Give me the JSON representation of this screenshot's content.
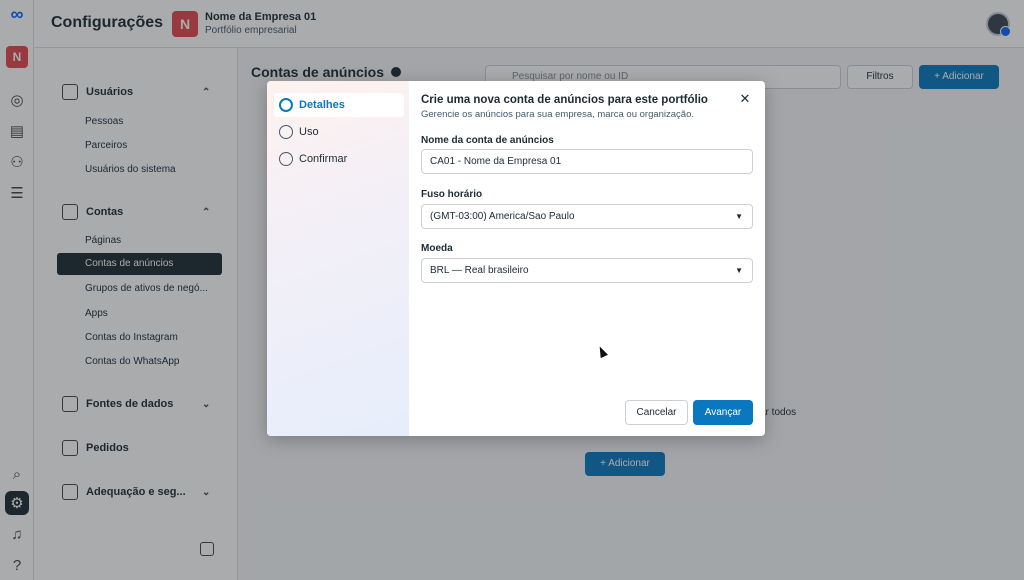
{
  "app": {
    "title": "Configurações",
    "business_initial": "N",
    "business_name": "Nome da Empresa 01",
    "business_subtitle": "Portfólio empresarial"
  },
  "rail": {
    "logo_icon": "meta-logo-icon",
    "business_initial": "N",
    "icons": [
      "compass-icon",
      "book-icon",
      "people-icon",
      "menu-icon",
      "search-icon",
      "gear-icon",
      "bell-icon",
      "help-icon"
    ]
  },
  "sidebar": {
    "sections": [
      {
        "label": "Usuários",
        "icon": "users-icon",
        "chevron": "up",
        "items": [
          "Pessoas",
          "Parceiros",
          "Usuários do sistema"
        ]
      },
      {
        "label": "Contas",
        "icon": "accounts-icon",
        "chevron": "up",
        "items": [
          "Páginas",
          "Contas de anúncios",
          "Grupos de ativos de negó...",
          "Apps",
          "Contas do Instagram",
          "Contas do WhatsApp"
        ]
      },
      {
        "label": "Fontes de dados",
        "icon": "data-sources-icon",
        "chevron": "down",
        "items": []
      },
      {
        "label": "Pedidos",
        "icon": "requests-icon",
        "chevron": "",
        "items": []
      },
      {
        "label": "Adequação e seg...",
        "icon": "shield-icon",
        "chevron": "down",
        "items": []
      }
    ],
    "active_item": "Contas de anúncios"
  },
  "main": {
    "title": "Contas de anúncios",
    "search_placeholder": "Pesquisar por nome ou ID",
    "filter_label": "Filtros",
    "add_label": "Adicionar",
    "partial_text": "ar todos",
    "add_label_2": "Adicionar"
  },
  "modal": {
    "steps": [
      {
        "label": "Detalhes",
        "current": true
      },
      {
        "label": "Uso",
        "current": false
      },
      {
        "label": "Confirmar",
        "current": false
      }
    ],
    "title": "Crie uma nova conta de anúncios para este portfólio",
    "subtitle": "Gerencie os anúncios para sua empresa, marca ou organização.",
    "fields": {
      "account_name": {
        "label": "Nome da conta de anúncios",
        "value": "CA01 - Nome da Empresa 01"
      },
      "timezone": {
        "label": "Fuso horário",
        "value": "(GMT-03:00) America/Sao Paulo"
      },
      "currency": {
        "label": "Moeda",
        "value": "BRL — Real brasileiro"
      }
    },
    "cancel_label": "Cancelar",
    "next_label": "Avançar"
  },
  "colors": {
    "primary": "#0a78be",
    "brand_red": "#e3484e",
    "active_nav": "#1c2b33"
  }
}
